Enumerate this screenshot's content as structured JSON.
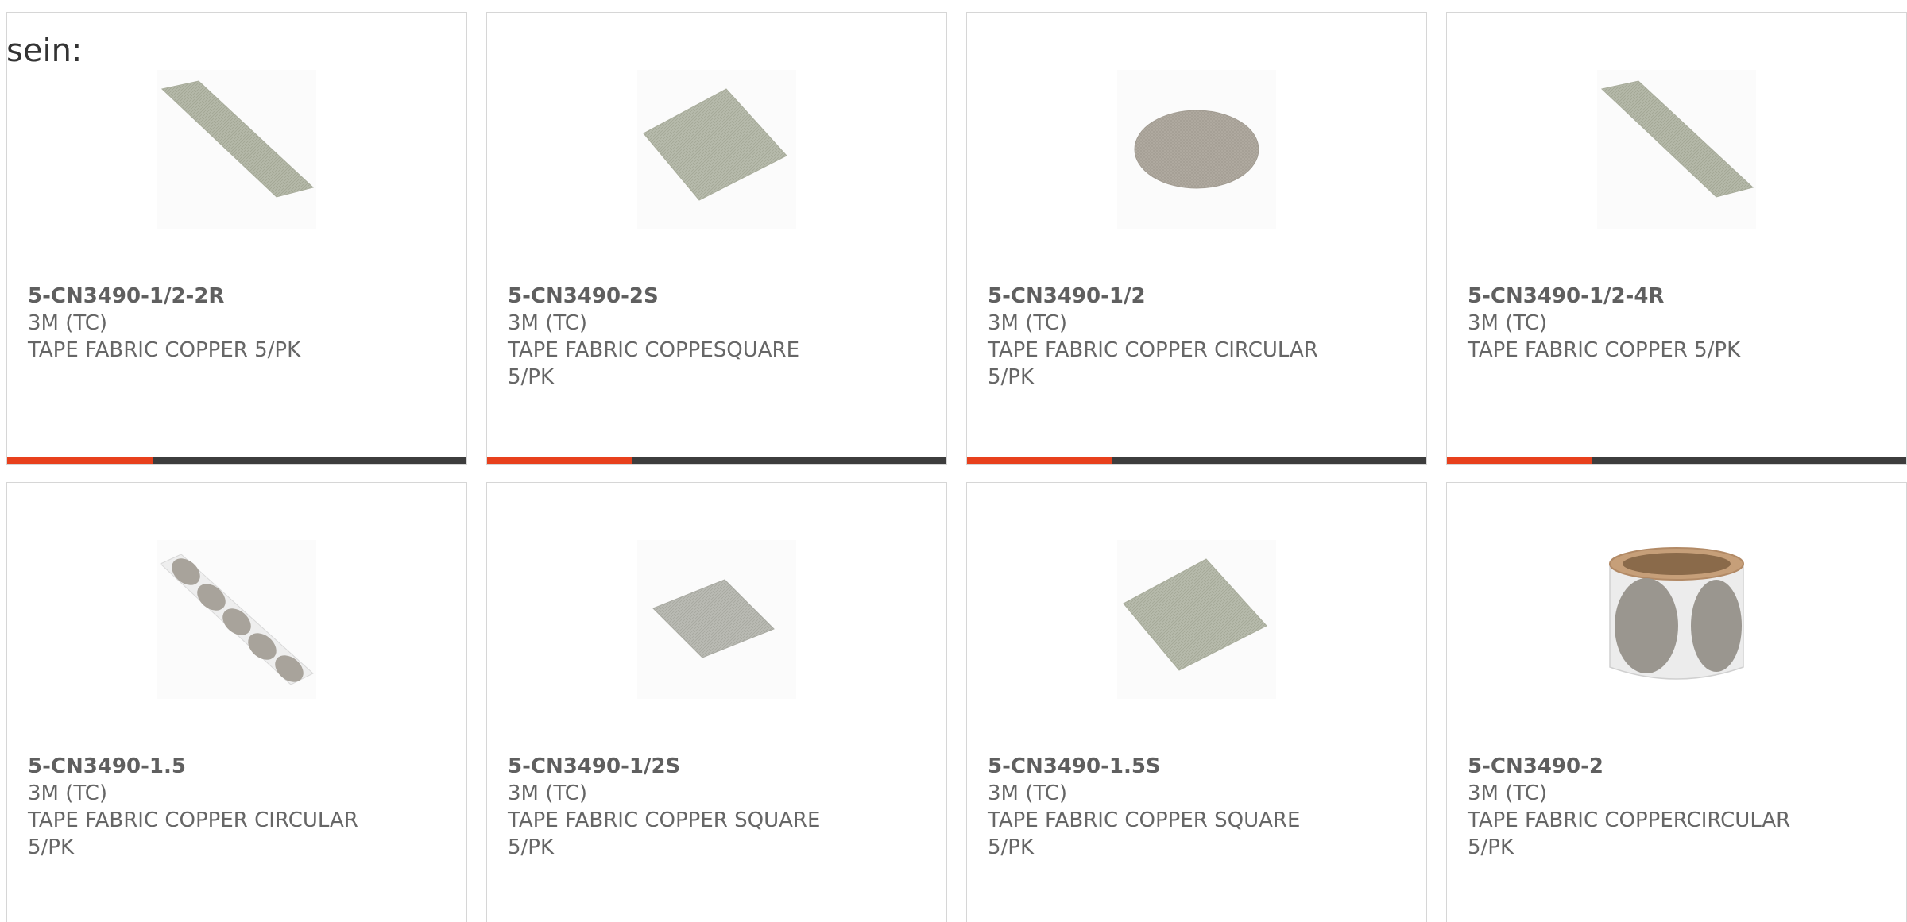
{
  "intro_text": "sein:",
  "colors": {
    "accent": "#e8401c",
    "bar": "#3d3d3d",
    "border": "#d6d6d6",
    "text": "#666666"
  },
  "products": [
    {
      "part_number": "5-CN3490-1/2-2R",
      "manufacturer": "3M (TC)",
      "description": "TAPE FABRIC COPPER 5/PK",
      "image": "fabric-strip",
      "bar": true
    },
    {
      "part_number": "5-CN3490-2S",
      "manufacturer": "3M (TC)",
      "description": "TAPE FABRIC COPPESQUARE 5/PK",
      "image": "fabric-square",
      "bar": true
    },
    {
      "part_number": "5-CN3490-1/2",
      "manufacturer": "3M (TC)",
      "description": "TAPE FABRIC COPPER CIRCULAR 5/PK",
      "image": "fabric-circle",
      "bar": true
    },
    {
      "part_number": "5-CN3490-1/2-4R",
      "manufacturer": "3M (TC)",
      "description": "TAPE FABRIC COPPER 5/PK",
      "image": "fabric-strip",
      "bar": true
    },
    {
      "part_number": "5-CN3490-1.5",
      "manufacturer": "3M (TC)",
      "description": "TAPE FABRIC COPPER CIRCULAR 5/PK",
      "image": "dot-strip",
      "bar": false
    },
    {
      "part_number": "5-CN3490-1/2S",
      "manufacturer": "3M (TC)",
      "description": "TAPE FABRIC COPPER SQUARE 5/PK",
      "image": "fabric-square-small",
      "bar": false
    },
    {
      "part_number": "5-CN3490-1.5S",
      "manufacturer": "3M (TC)",
      "description": "TAPE FABRIC COPPER SQUARE 5/PK",
      "image": "fabric-square",
      "bar": false
    },
    {
      "part_number": "5-CN3490-2",
      "manufacturer": "3M (TC)",
      "description": "TAPE FABRIC COPPERCIRCULAR 5/PK",
      "image": "dot-roll",
      "bar": false
    }
  ]
}
